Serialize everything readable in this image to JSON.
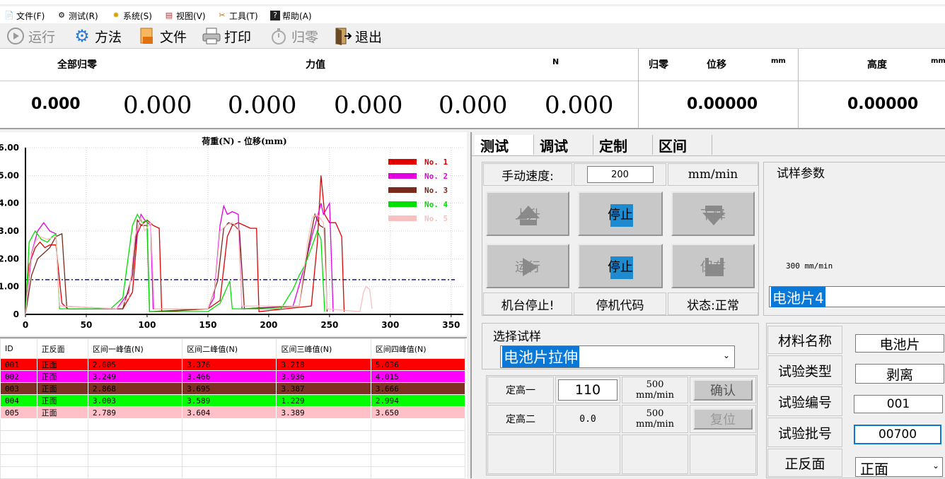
{
  "menu": [
    {
      "icon": "file-icon",
      "label": "文件(F)"
    },
    {
      "icon": "test-icon",
      "label": "测试(R)"
    },
    {
      "icon": "system-icon",
      "label": "系统(S)"
    },
    {
      "icon": "view-icon",
      "label": "视图(V)"
    },
    {
      "icon": "tools-icon",
      "label": "工具(T)"
    },
    {
      "icon": "help-icon",
      "label": "帮助(A)"
    }
  ],
  "toolbar": {
    "run": "运行",
    "method": "方法",
    "file": "文件",
    "print": "打印",
    "zero": "归零",
    "exit": "退出"
  },
  "readout": {
    "zero_all": "全部归零",
    "force": "力值",
    "force_unit": "N",
    "zero": "归零",
    "displacement": "位移",
    "disp_unit": "mm",
    "height": "高度",
    "height_unit": "mm",
    "forces": [
      "0.000",
      "0.000",
      "0.000",
      "0.000",
      "0.000",
      "0.000"
    ],
    "displacement_value": "0.00000",
    "height_value": "0.00000"
  },
  "chart_data": {
    "type": "line",
    "title": "荷重(N) - 位移(mm)",
    "xlim": [
      0,
      360
    ],
    "ylim": [
      0,
      6
    ],
    "x_ticks": [
      "0",
      "50",
      "100",
      "150",
      "200",
      "250",
      "300",
      "350"
    ],
    "y_ticks": [
      "0",
      "1.00",
      "2.00",
      "3.00",
      "4.00",
      "5.00",
      "6.00"
    ],
    "reference_line": 1.25,
    "legend_position": "top-right",
    "series": [
      {
        "name": "No. 1",
        "color": "#e00000",
        "points": [
          [
            0,
            0
          ],
          [
            3,
            1.8
          ],
          [
            8,
            2.4
          ],
          [
            12,
            2.6
          ],
          [
            16,
            2.4
          ],
          [
            20,
            2.5
          ],
          [
            25,
            2.5
          ],
          [
            30,
            0.4
          ],
          [
            35,
            0.2
          ],
          [
            80,
            0.2
          ],
          [
            88,
            0.8
          ],
          [
            92,
            2.9
          ],
          [
            95,
            3.2
          ],
          [
            100,
            3.4
          ],
          [
            105,
            3.2
          ],
          [
            110,
            3.1
          ],
          [
            112,
            0.1
          ],
          [
            150,
            0.2
          ],
          [
            160,
            0.5
          ],
          [
            166,
            2.8
          ],
          [
            170,
            3.2
          ],
          [
            175,
            3.3
          ],
          [
            180,
            3.2
          ],
          [
            185,
            3.1
          ],
          [
            190,
            3.1
          ],
          [
            192,
            0.1
          ],
          [
            235,
            0.3
          ],
          [
            240,
            2.6
          ],
          [
            243,
            5.0
          ],
          [
            246,
            3.6
          ],
          [
            250,
            3.3
          ],
          [
            255,
            3.3
          ],
          [
            260,
            2.8
          ],
          [
            262,
            0.1
          ]
        ]
      },
      {
        "name": "No. 2",
        "color": "#e000e0",
        "points": [
          [
            0,
            0
          ],
          [
            5,
            2.2
          ],
          [
            10,
            3.0
          ],
          [
            15,
            3.3
          ],
          [
            20,
            3.0
          ],
          [
            25,
            2.9
          ],
          [
            28,
            0.3
          ],
          [
            75,
            0.2
          ],
          [
            85,
            0.8
          ],
          [
            92,
            3.0
          ],
          [
            95,
            3.6
          ],
          [
            98,
            3.4
          ],
          [
            103,
            3.2
          ],
          [
            105,
            0.2
          ],
          [
            150,
            0.2
          ],
          [
            155,
            0.6
          ],
          [
            160,
            3.2
          ],
          [
            163,
            3.9
          ],
          [
            166,
            3.6
          ],
          [
            170,
            3.7
          ],
          [
            175,
            3.6
          ],
          [
            178,
            0.2
          ],
          [
            220,
            0.3
          ],
          [
            230,
            1.8
          ],
          [
            236,
            2.9
          ],
          [
            240,
            3.5
          ],
          [
            243,
            4.0
          ],
          [
            245,
            3.6
          ],
          [
            250,
            4.0
          ],
          [
            253,
            0.1
          ]
        ]
      },
      {
        "name": "No. 3",
        "color": "#7a2a1a",
        "points": [
          [
            0,
            0
          ],
          [
            5,
            1.4
          ],
          [
            10,
            2.0
          ],
          [
            15,
            2.2
          ],
          [
            20,
            2.4
          ],
          [
            25,
            2.8
          ],
          [
            30,
            2.9
          ],
          [
            34,
            0.2
          ],
          [
            80,
            0.2
          ],
          [
            88,
            1.4
          ],
          [
            92,
            3.4
          ],
          [
            95,
            3.2
          ],
          [
            100,
            3.2
          ],
          [
            102,
            0.1
          ],
          [
            150,
            0.2
          ],
          [
            158,
            1.2
          ],
          [
            163,
            3.1
          ],
          [
            167,
            3.3
          ],
          [
            172,
            3.2
          ],
          [
            176,
            3.0
          ],
          [
            180,
            0.2
          ],
          [
            225,
            0.3
          ],
          [
            233,
            2.5
          ],
          [
            238,
            3.6
          ],
          [
            242,
            3.2
          ],
          [
            246,
            3.1
          ],
          [
            248,
            0.1
          ]
        ]
      },
      {
        "name": "No. 4",
        "color": "#00e000",
        "points": [
          [
            0,
            0
          ],
          [
            3,
            2.6
          ],
          [
            8,
            3.0
          ],
          [
            13,
            2.7
          ],
          [
            18,
            2.6
          ],
          [
            22,
            2.8
          ],
          [
            25,
            2.9
          ],
          [
            28,
            0.2
          ],
          [
            70,
            0.2
          ],
          [
            80,
            0.6
          ],
          [
            88,
            3.2
          ],
          [
            92,
            3.6
          ],
          [
            96,
            3.3
          ],
          [
            100,
            3.4
          ],
          [
            102,
            0.1
          ],
          [
            150,
            0.1
          ],
          [
            160,
            0.4
          ],
          [
            165,
            0.9
          ],
          [
            168,
            1.2
          ],
          [
            170,
            0.2
          ],
          [
            210,
            0.2
          ],
          [
            220,
            0.9
          ],
          [
            225,
            1.4
          ],
          [
            230,
            1.8
          ],
          [
            236,
            2.5
          ],
          [
            240,
            3.0
          ],
          [
            243,
            2.7
          ],
          [
            246,
            0.1
          ]
        ]
      },
      {
        "name": "No. 5",
        "color": "#f8c0c0",
        "points": [
          [
            0,
            0
          ],
          [
            4,
            2.0
          ],
          [
            8,
            2.6
          ],
          [
            12,
            2.8
          ],
          [
            18,
            2.7
          ],
          [
            25,
            2.8
          ],
          [
            28,
            0.3
          ],
          [
            75,
            0.2
          ],
          [
            85,
            0.6
          ],
          [
            90,
            2.8
          ],
          [
            95,
            3.5
          ],
          [
            98,
            3.0
          ],
          [
            103,
            3.3
          ],
          [
            106,
            0.2
          ],
          [
            150,
            0.2
          ],
          [
            156,
            1.0
          ],
          [
            160,
            3.0
          ],
          [
            165,
            3.2
          ],
          [
            170,
            3.3
          ],
          [
            175,
            3.1
          ],
          [
            178,
            0.3
          ],
          [
            225,
            0.3
          ],
          [
            232,
            2.6
          ],
          [
            236,
            3.5
          ],
          [
            240,
            3.6
          ],
          [
            245,
            3.3
          ],
          [
            248,
            0.2
          ],
          [
            275,
            0.1
          ],
          [
            278,
            0.8
          ],
          [
            280,
            1.0
          ],
          [
            283,
            0.9
          ],
          [
            285,
            0.2
          ]
        ]
      }
    ]
  },
  "table": {
    "headers": [
      "ID",
      "正反面",
      "区间一峰值(N)",
      "区间二峰值(N)",
      "区间三峰值(N)",
      "区间四峰值(N)"
    ],
    "rows": [
      {
        "bg": "#ff0000",
        "cells": [
          "001",
          "正面",
          "2.605",
          "3.376",
          "3.218",
          "5.036"
        ]
      },
      {
        "bg": "#ff00ff",
        "cells": [
          "002",
          "正面",
          "3.249",
          "3.466",
          "3.936",
          "4.015"
        ]
      },
      {
        "bg": "#803020",
        "cells": [
          "003",
          "正面",
          "2.868",
          "3.695",
          "3.387",
          "3.666"
        ]
      },
      {
        "bg": "#00ff00",
        "cells": [
          "004",
          "正面",
          "3.003",
          "3.589",
          "1.229",
          "2.994"
        ]
      },
      {
        "bg": "#ffc0c8",
        "cells": [
          "005",
          "正面",
          "2.789",
          "3.604",
          "3.389",
          "3.650"
        ]
      }
    ]
  },
  "tabs": [
    "测试",
    "调试",
    "定制",
    "区间"
  ],
  "manual": {
    "speed_label": "手动速度:",
    "speed_value": "200",
    "speed_unit": "mm/min",
    "up": "上升",
    "stop": "停止",
    "down": "下降",
    "run": "运行",
    "stop2": "停止",
    "save": "保存",
    "machine_status": "机台停止!",
    "stop_code": "停机代码",
    "state": "状态:正常"
  },
  "sample_params": {
    "title": "试样参数",
    "speed_text": "300 mm/min",
    "selected": "电池片4"
  },
  "select_sample": {
    "title": "选择试样",
    "selected": "电池片拉伸"
  },
  "height": {
    "label1": "定高一",
    "value1": "110",
    "rate1_a": "500",
    "rate1_b": "mm/min",
    "confirm": "确认",
    "label2": "定高二",
    "value2": "0.0",
    "rate2_a": "500",
    "rate2_b": "mm/min",
    "reset": "复位"
  },
  "info": {
    "material_label": "材料名称",
    "material": "电池片",
    "type_label": "试验类型",
    "type": "剥离",
    "number_label": "试验编号",
    "number": "001",
    "batch_label": "试验批号",
    "batch": "00700",
    "side_label": "正反面",
    "side": "正面"
  }
}
